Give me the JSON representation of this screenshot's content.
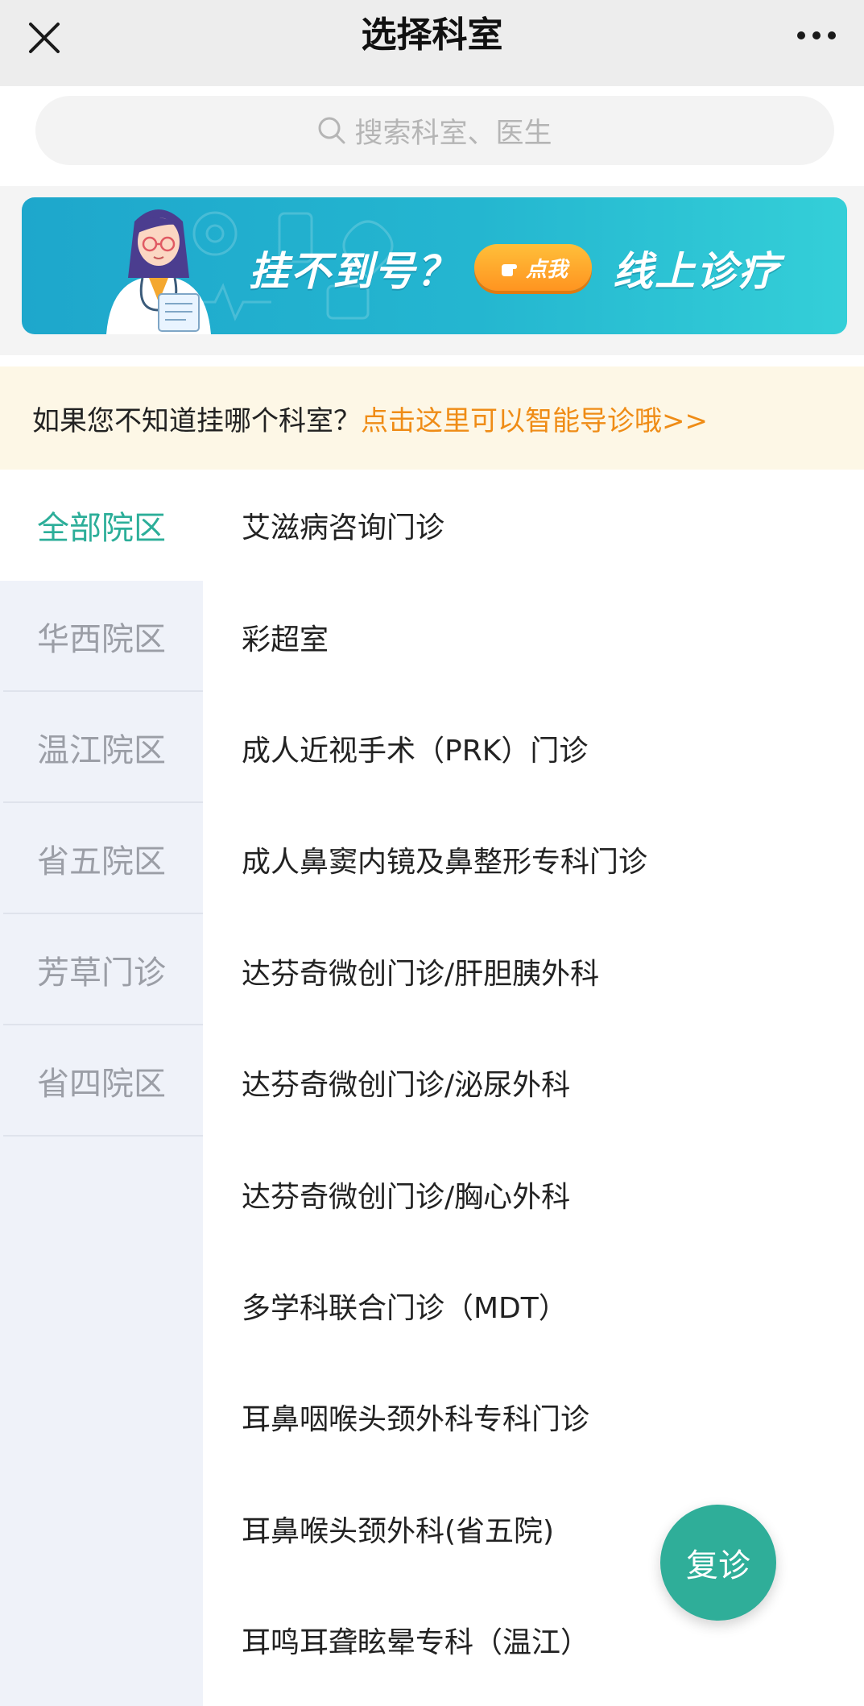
{
  "header": {
    "title": "选择科室"
  },
  "search": {
    "placeholder": "搜索科室、医生"
  },
  "banner": {
    "text_left": "挂不到号？",
    "button_label": "点我",
    "text_right": "线上诊疗"
  },
  "tip": {
    "text": "如果您不知道挂哪个科室？",
    "link": "点击这里可以智能导诊哦>>"
  },
  "campuses": [
    {
      "label": "全部院区",
      "active": true
    },
    {
      "label": "华西院区",
      "active": false
    },
    {
      "label": "温江院区",
      "active": false
    },
    {
      "label": "省五院区",
      "active": false
    },
    {
      "label": "芳草门诊",
      "active": false
    },
    {
      "label": "省四院区",
      "active": false
    }
  ],
  "departments": [
    "艾滋病咨询门诊",
    "彩超室",
    "成人近视手术（PRK）门诊",
    "成人鼻窦内镜及鼻整形专科门诊",
    "达芬奇微创门诊/肝胆胰外科",
    "达芬奇微创门诊/泌尿外科",
    "达芬奇微创门诊/胸心外科",
    "多学科联合门诊（MDT）",
    "耳鼻咽喉头颈外科专科门诊",
    "耳鼻喉头颈外科(省五院)",
    "耳鸣耳聋眩晕专科（温江）"
  ],
  "fab": {
    "label": "复诊"
  },
  "colors": {
    "accent": "#2fae99",
    "link": "#ef8c16",
    "nav_bg": "#eff2f9",
    "tip_bg": "#fdf7e6"
  },
  "icons": {
    "close": "close-icon",
    "more": "more-icon",
    "search": "search-icon",
    "hand": "hand-pointer-icon"
  }
}
